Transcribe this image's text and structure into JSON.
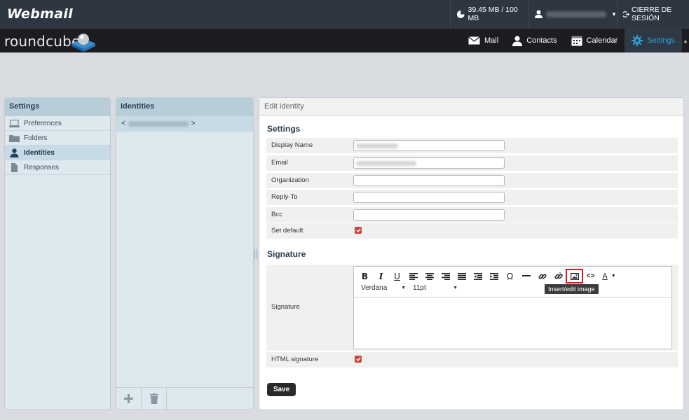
{
  "topbar": {
    "brand": "Webmail",
    "quota": "39.45 MB / 100 MB",
    "logout": "CIERRE DE SESIÓN"
  },
  "header": {
    "logo_text": "roundcube",
    "nav": [
      {
        "label": "Mail",
        "icon": "envelope-icon"
      },
      {
        "label": "Contacts",
        "icon": "person-icon"
      },
      {
        "label": "Calendar",
        "icon": "calendar-icon"
      },
      {
        "label": "Settings",
        "icon": "gear-icon",
        "active": true
      }
    ]
  },
  "settings_panel": {
    "title": "Settings",
    "items": [
      {
        "label": "Preferences",
        "icon": "laptop-icon"
      },
      {
        "label": "Folders",
        "icon": "folder-icon"
      },
      {
        "label": "Identities",
        "icon": "person-icon",
        "selected": true
      },
      {
        "label": "Responses",
        "icon": "document-icon"
      }
    ]
  },
  "identities_panel": {
    "title": "Identities",
    "rows": [
      {
        "prefix": "<",
        "suffix": ">"
      }
    ]
  },
  "edit_panel": {
    "title": "Edit identity",
    "settings_title": "Settings",
    "fields": {
      "display_name": {
        "label": "Display Name",
        "value": ""
      },
      "email": {
        "label": "Email",
        "value": ""
      },
      "organization": {
        "label": "Organization",
        "value": ""
      },
      "reply_to": {
        "label": "Reply-To",
        "value": ""
      },
      "bcc": {
        "label": "Bcc",
        "value": ""
      },
      "set_default": {
        "label": "Set default",
        "checked": true
      }
    },
    "signature_title": "Signature",
    "signature_label": "Signature",
    "editor": {
      "font": "Verdana",
      "size": "11pt",
      "tooltip": "Insert/edit image"
    },
    "html_signature": {
      "label": "HTML signature",
      "checked": true
    },
    "save_label": "Save"
  },
  "colors": {
    "topbar": "#2e3641",
    "header": "#1c1d20",
    "accent": "#2f9ed8",
    "checkbox": "#c9463d",
    "highlight": "#e3141c"
  }
}
